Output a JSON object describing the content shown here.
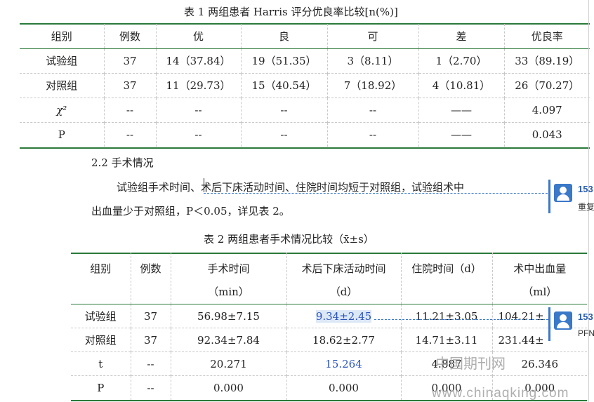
{
  "table1": {
    "caption": "表 1 两组患者 Harris 评分优良率比较[n(%)]",
    "headers": [
      "组别",
      "例数",
      "优",
      "良",
      "可",
      "差",
      "优良率"
    ],
    "rows": [
      [
        "试验组",
        "37",
        "14（37.84）",
        "19（51.35）",
        "3（8.11）",
        "1（2.70）",
        "33（89.19）"
      ],
      [
        "对照组",
        "37",
        "11（29.73）",
        "15（40.54）",
        "7（18.92）",
        "4（10.81）",
        "26（70.27）"
      ],
      [
        "χ²",
        "--",
        "--",
        "--",
        "--",
        "——",
        "4.097"
      ],
      [
        "P",
        "--",
        "--",
        "--",
        "--",
        "——",
        "0.043"
      ]
    ]
  },
  "section": {
    "heading": "2.2 手术情况",
    "para_line1": "试验组手术时间、术后下床活动时间、住院时间均短于对照组，试验组术中",
    "para_line2": "出血量少于对照组，P＜0.05，详见表 2。"
  },
  "table2": {
    "caption": "表 2 两组患者手术情况比较（x̄±s）",
    "headers": [
      {
        "top": "组别",
        "bottom": ""
      },
      {
        "top": "例数",
        "bottom": ""
      },
      {
        "top": "手术时间",
        "bottom": "（min）"
      },
      {
        "top": "术后下床活动时间",
        "bottom": "（d）"
      },
      {
        "top": "住院时间（d）",
        "bottom": ""
      },
      {
        "top": "术中出血量",
        "bottom": "（ml）"
      }
    ],
    "rows": [
      [
        "试验组",
        "37",
        "56.98±7.15",
        "9.34±2.45",
        "11.21±3.05",
        "104.21±"
      ],
      [
        "对照组",
        "37",
        "92.34±7.84",
        "18.62±2.77",
        "14.71±3.11",
        "231.44±"
      ],
      [
        "t",
        "--",
        "20.271",
        "15.264",
        "4.887",
        "26.346"
      ],
      [
        "P",
        "--",
        "0.000",
        "0.000",
        "0.000",
        "0.000"
      ]
    ]
  },
  "comments": [
    {
      "id": "153",
      "text": "重复"
    },
    {
      "id": "153",
      "text": "PFN"
    }
  ],
  "watermark": {
    "cn": "中国期刊网",
    "url": "www.chinaqking.com"
  },
  "colors": {
    "rule_green": "#2a7a3a",
    "highlight_blue": "#2a52be",
    "comment_blue": "#3a78c8"
  }
}
